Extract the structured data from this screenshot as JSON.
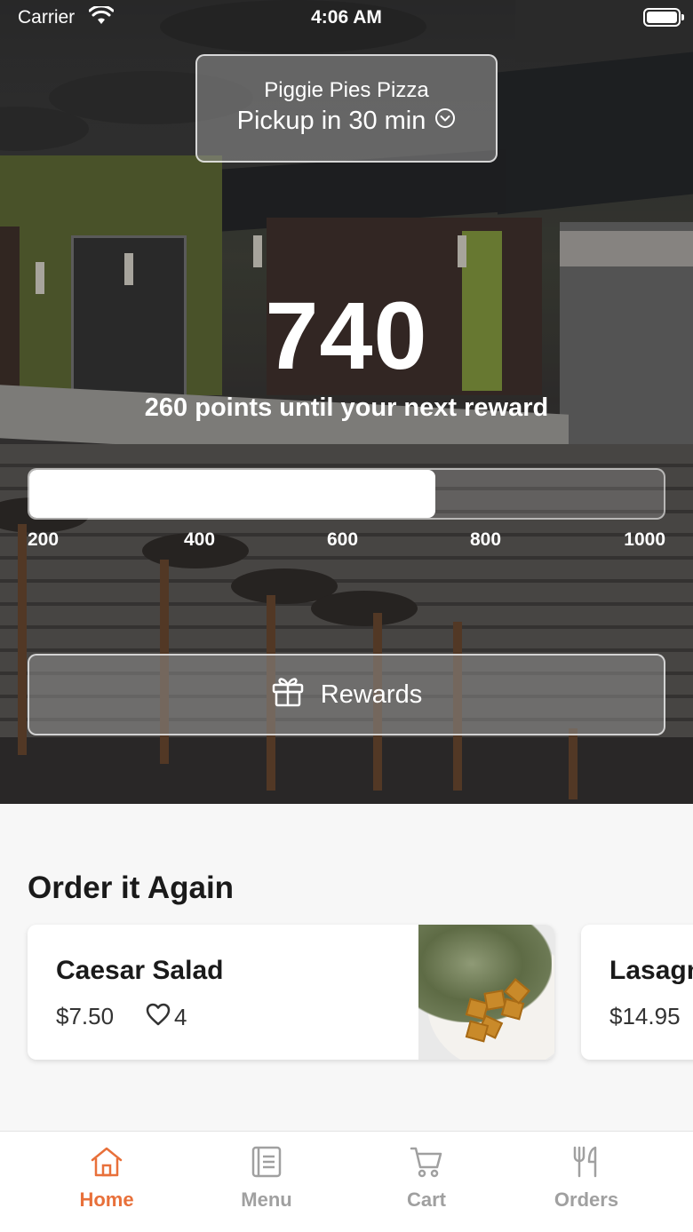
{
  "status_bar": {
    "carrier": "Carrier",
    "time": "4:06 AM"
  },
  "store": {
    "name": "Piggie Pies Pizza",
    "pickup": "Pickup in 30 min"
  },
  "rewards": {
    "points": "740",
    "points_subtitle": "260 points until your next reward",
    "progress_fraction": 0.64,
    "ticks": [
      "200",
      "400",
      "600",
      "800",
      "1000"
    ],
    "button_label": "Rewards"
  },
  "order_again": {
    "title": "Order it Again",
    "items": [
      {
        "name": "Caesar Salad",
        "price": "$7.50",
        "likes": "4"
      },
      {
        "name": "Lasagna",
        "price": "$14.95"
      }
    ]
  },
  "tabs": [
    {
      "label": "Home",
      "icon": "home-icon",
      "active": true
    },
    {
      "label": "Menu",
      "icon": "menu-icon",
      "active": false
    },
    {
      "label": "Cart",
      "icon": "cart-icon",
      "active": false
    },
    {
      "label": "Orders",
      "icon": "utensils-icon",
      "active": false
    }
  ],
  "colors": {
    "accent": "#e8703a",
    "inactive_tab": "#a0a0a0"
  }
}
